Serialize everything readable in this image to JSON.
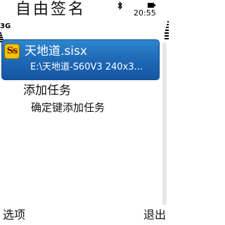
{
  "status_bar": {
    "app_title": "自由签名",
    "time": "20:55",
    "network": "3G",
    "icons": [
      "bluetooth-icon",
      "battery-icon",
      "signal-strength-icon",
      "battery-level-icon"
    ]
  },
  "list": {
    "items": [
      {
        "icon": "sis-package-icon",
        "icon_text": "Ss",
        "title": "天地道.sisx",
        "subtitle": "E:\\天地道-S60V3 240x3...",
        "selected": true
      },
      {
        "title": "添加任务",
        "subtitle": "确定键添加任务",
        "selected": false
      }
    ]
  },
  "softkeys": {
    "left": "选项",
    "right": "退出"
  },
  "colors": {
    "highlight": "#1e69b6",
    "icon_bg": "#f0c200",
    "text": "#111111"
  }
}
